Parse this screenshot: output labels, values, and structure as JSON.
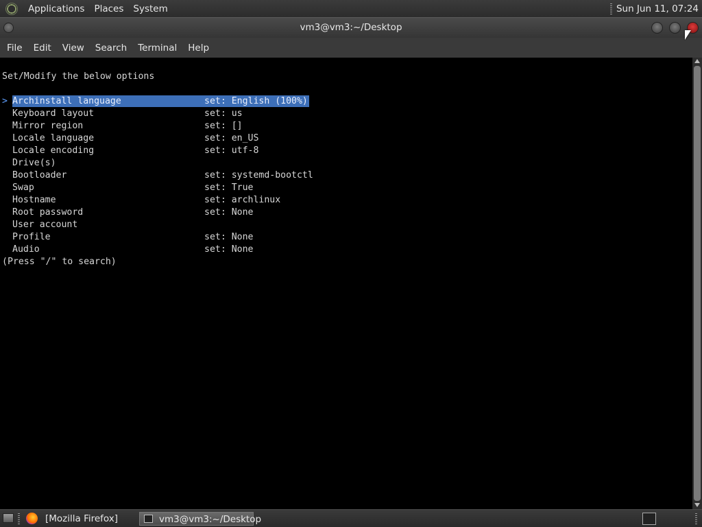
{
  "top_panel": {
    "menus": [
      "Applications",
      "Places",
      "System"
    ],
    "clock": "Sun Jun 11, 07:24"
  },
  "window": {
    "title": "vm3@vm3:~/Desktop",
    "menus": [
      "File",
      "Edit",
      "View",
      "Search",
      "Terminal",
      "Help"
    ]
  },
  "terminal": {
    "heading": "Set/Modify the below options",
    "cursor": ">",
    "options": [
      {
        "name": "Archinstall language",
        "value": "set: English (100%)",
        "selected": true
      },
      {
        "name": "Keyboard layout",
        "value": "set: us"
      },
      {
        "name": "Mirror region",
        "value": "set: []"
      },
      {
        "name": "Locale language",
        "value": "set: en_US"
      },
      {
        "name": "Locale encoding",
        "value": "set: utf-8"
      },
      {
        "name": "Drive(s)",
        "value": ""
      },
      {
        "name": "Bootloader",
        "value": "set: systemd-bootctl"
      },
      {
        "name": "Swap",
        "value": "set: True"
      },
      {
        "name": "Hostname",
        "value": "set: archlinux"
      },
      {
        "name": "Root password",
        "value": "set: None"
      },
      {
        "name": "User account",
        "value": ""
      },
      {
        "name": "Profile",
        "value": "set: None"
      },
      {
        "name": "Audio",
        "value": "set: None"
      }
    ],
    "footer": "(Press \"/\" to search)"
  },
  "taskbar": {
    "tasks": [
      "[Mozilla Firefox]",
      "vm3@vm3:~/Desktop"
    ]
  },
  "colors": {
    "selection": "#3d6fb8",
    "terminal_bg": "#000000",
    "terminal_fg": "#d7d7d7"
  }
}
